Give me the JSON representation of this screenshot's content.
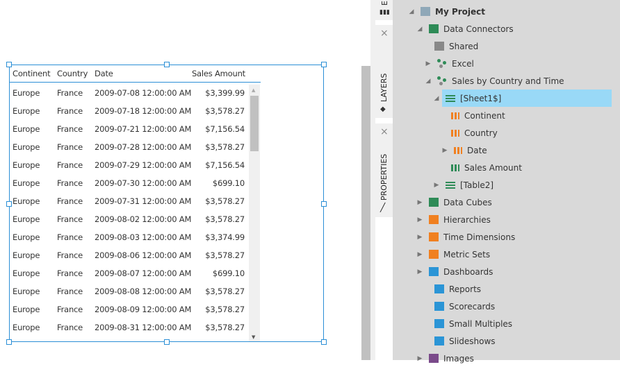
{
  "table": {
    "columns": [
      "Continent",
      "Country",
      "Date",
      "Sales Amount"
    ],
    "rows": [
      [
        "Europe",
        "France",
        "2009-07-08 12:00:00 AM",
        "$3,399.99"
      ],
      [
        "Europe",
        "France",
        "2009-07-18 12:00:00 AM",
        "$3,578.27"
      ],
      [
        "Europe",
        "France",
        "2009-07-21 12:00:00 AM",
        "$7,156.54"
      ],
      [
        "Europe",
        "France",
        "2009-07-28 12:00:00 AM",
        "$3,578.27"
      ],
      [
        "Europe",
        "France",
        "2009-07-29 12:00:00 AM",
        "$7,156.54"
      ],
      [
        "Europe",
        "France",
        "2009-07-30 12:00:00 AM",
        "$699.10"
      ],
      [
        "Europe",
        "France",
        "2009-07-31 12:00:00 AM",
        "$3,578.27"
      ],
      [
        "Europe",
        "France",
        "2009-08-02 12:00:00 AM",
        "$3,578.27"
      ],
      [
        "Europe",
        "France",
        "2009-08-03 12:00:00 AM",
        "$3,374.99"
      ],
      [
        "Europe",
        "France",
        "2009-08-06 12:00:00 AM",
        "$3,578.27"
      ],
      [
        "Europe",
        "France",
        "2009-08-07 12:00:00 AM",
        "$699.10"
      ],
      [
        "Europe",
        "France",
        "2009-08-08 12:00:00 AM",
        "$3,578.27"
      ],
      [
        "Europe",
        "France",
        "2009-08-09 12:00:00 AM",
        "$3,578.27"
      ],
      [
        "Europe",
        "France",
        "2009-08-31 12:00:00 AM",
        "$3,578.27"
      ]
    ]
  },
  "side_tabs": {
    "top_label": "E",
    "layers": "LAYERS",
    "properties": "PROPERTIES",
    "close": "×"
  },
  "tree": [
    {
      "label": "My Project",
      "arrow": "◢",
      "icon": "briefcase-icon",
      "color": "#8fa8b8",
      "bold": true
    },
    {
      "label": "Data Connectors",
      "arrow": "◢",
      "icon": "data-connectors-icon",
      "color": "#2e8b57"
    },
    {
      "label": "Shared",
      "arrow": "",
      "icon": "shared-folder-icon",
      "color": "#888888"
    },
    {
      "label": "Excel",
      "arrow": "▶",
      "icon": "connector-icon",
      "color": "#2e8b57"
    },
    {
      "label": "Sales by Country and Time",
      "arrow": "◢",
      "icon": "connector-icon",
      "color": "#2e8b57"
    },
    {
      "label": "[Sheet1$]",
      "arrow": "◢",
      "icon": "table-icon",
      "color": "#2e8b57",
      "selected": true
    },
    {
      "label": "Continent",
      "arrow": "",
      "icon": "column-icon",
      "color": "#f08020"
    },
    {
      "label": "Country",
      "arrow": "",
      "icon": "column-icon",
      "color": "#f08020"
    },
    {
      "label": "Date",
      "arrow": "▶",
      "icon": "column-icon",
      "color": "#f08020"
    },
    {
      "label": "Sales Amount",
      "arrow": "",
      "icon": "column-icon",
      "color": "#2e8b57"
    },
    {
      "label": "[Table2]",
      "arrow": "▶",
      "icon": "table-icon",
      "color": "#2e8b57"
    },
    {
      "label": "Data Cubes",
      "arrow": "▶",
      "icon": "data-cube-icon",
      "color": "#2e8b57"
    },
    {
      "label": "Hierarchies",
      "arrow": "▶",
      "icon": "hierarchy-icon",
      "color": "#f08020"
    },
    {
      "label": "Time Dimensions",
      "arrow": "▶",
      "icon": "hourglass-icon",
      "color": "#f08020"
    },
    {
      "label": "Metric Sets",
      "arrow": "▶",
      "icon": "metric-set-icon",
      "color": "#f08020"
    },
    {
      "label": "Dashboards",
      "arrow": "▶",
      "icon": "dashboard-icon",
      "color": "#2b95d6"
    },
    {
      "label": "Reports",
      "arrow": "",
      "icon": "report-icon",
      "color": "#2b95d6"
    },
    {
      "label": "Scorecards",
      "arrow": "",
      "icon": "scorecard-icon",
      "color": "#2b95d6"
    },
    {
      "label": "Small Multiples",
      "arrow": "",
      "icon": "small-multiples-icon",
      "color": "#2b95d6"
    },
    {
      "label": "Slideshows",
      "arrow": "",
      "icon": "slideshow-icon",
      "color": "#2b95d6"
    },
    {
      "label": "Images",
      "arrow": "▶",
      "icon": "image-icon",
      "color": "#7a4a8a"
    }
  ],
  "colors": {
    "accent": "#2b8fd6",
    "selection": "#99d9f7",
    "panel": "#d9d9d9"
  }
}
